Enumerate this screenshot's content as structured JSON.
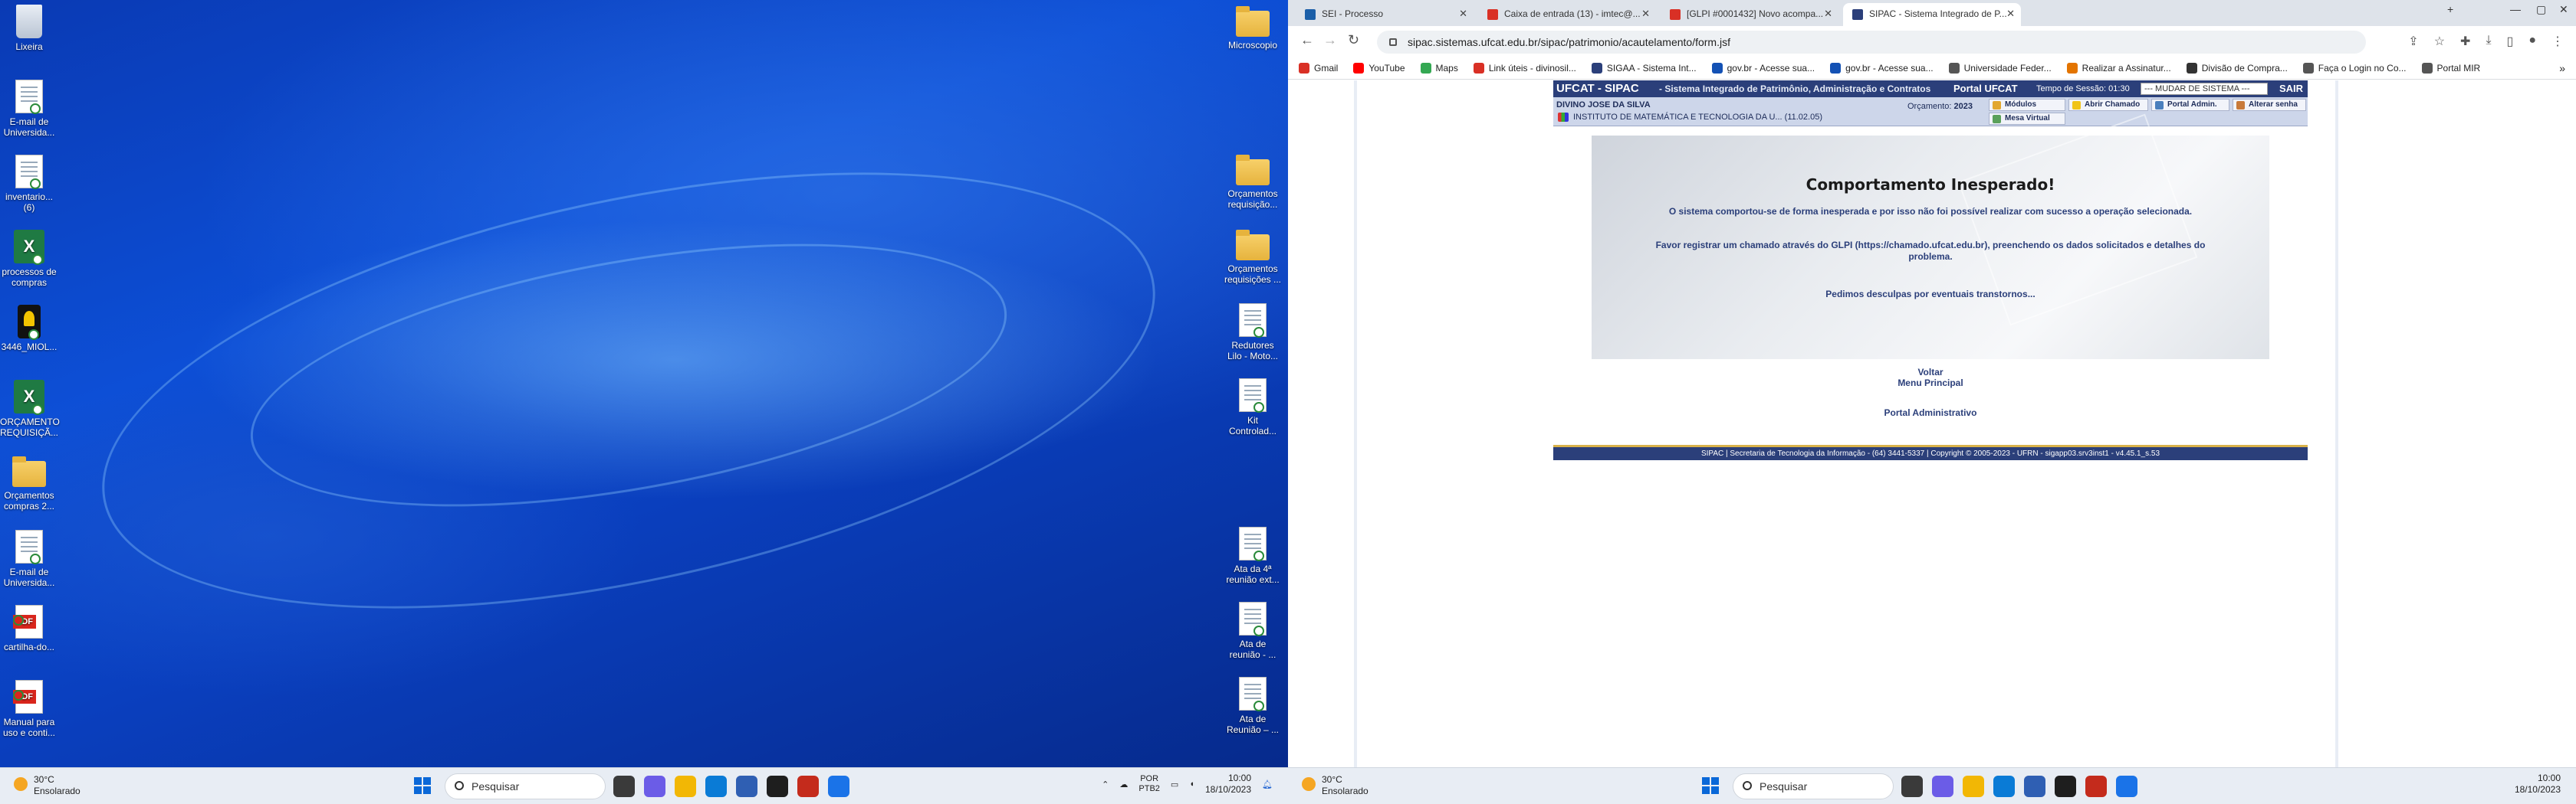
{
  "desktop": {
    "left_icons": [
      {
        "label": "Lixeira",
        "type": "recycle"
      },
      {
        "label": "E-mail de Universida...",
        "type": "doc"
      },
      {
        "label": "inventario... (6)",
        "type": "doc"
      },
      {
        "label": "processos de compras",
        "type": "excel"
      },
      {
        "label": "3446_MIOL...",
        "type": "black"
      },
      {
        "label": "ORÇAMENTO REQUISIÇÃ...",
        "type": "excel"
      },
      {
        "label": "Orçamentos compras 2...",
        "type": "folder"
      },
      {
        "label": "E-mail de Universida...",
        "type": "doc"
      },
      {
        "label": "cartilha-do...",
        "type": "pdf"
      },
      {
        "label": "Manual para uso e conti...",
        "type": "pdf"
      }
    ],
    "right_icons": [
      {
        "label": "Microscopio",
        "type": "folder"
      },
      {
        "label": "Orçamentos requisição...",
        "type": "folder"
      },
      {
        "label": "Orçamentos requisições ...",
        "type": "folder"
      },
      {
        "label": "Redutores Lilo - Moto...",
        "type": "doc"
      },
      {
        "label": "Kit Controlad...",
        "type": "doc"
      },
      {
        "label": "Ata da 4ª reunião ext...",
        "type": "doc"
      },
      {
        "label": "Ata de reunião - ...",
        "type": "doc"
      },
      {
        "label": "Ata de Reunião – ...",
        "type": "doc"
      }
    ],
    "pdf_badge": "PDF",
    "excel_badge": "X"
  },
  "taskbar": {
    "temp": "30°C",
    "weather": "Ensolarado",
    "search_placeholder": "Pesquisar",
    "lang1": "POR",
    "lang2": "PTB2",
    "time": "10:00",
    "date": "18/10/2023",
    "app_colors": [
      "#3a3a3a",
      "#6b5ce7",
      "#f2b705",
      "#0a7bd6",
      "#2f5fb3",
      "#1e1e1e",
      "#c42b1c",
      "#1a73e8"
    ]
  },
  "browser": {
    "tabs": [
      {
        "label": "SEI - Processo",
        "color": "#1b5fa8",
        "active": false
      },
      {
        "label": "Caixa de entrada (13) - imtec@...",
        "color": "#d93025",
        "active": false
      },
      {
        "label": "[GLPI #0001432] Novo acompa...",
        "color": "#d93025",
        "active": false
      },
      {
        "label": "SIPAC - Sistema Integrado de P...",
        "color": "#2b3f7a",
        "active": true
      }
    ],
    "url": "sipac.sistemas.ufcat.edu.br/sipac/patrimonio/acautelamento/form.jsf",
    "bookmarks": [
      {
        "label": "Gmail",
        "color": "#d93025"
      },
      {
        "label": "YouTube",
        "color": "#ff0000"
      },
      {
        "label": "Maps",
        "color": "#34a853"
      },
      {
        "label": "Link úteis - divinosil...",
        "color": "#d93025"
      },
      {
        "label": "SIGAA - Sistema Int...",
        "color": "#2b3f7a"
      },
      {
        "label": "gov.br - Acesse sua...",
        "color": "#1351b4"
      },
      {
        "label": "gov.br - Acesse sua...",
        "color": "#1351b4"
      },
      {
        "label": "Universidade Feder...",
        "color": "#555555"
      },
      {
        "label": "Realizar a Assinatur...",
        "color": "#e37400"
      },
      {
        "label": "Divisão de Compra...",
        "color": "#333333"
      },
      {
        "label": "Faça o Login no Co...",
        "color": "#555555"
      },
      {
        "label": "Portal MIR",
        "color": "#555555"
      }
    ]
  },
  "sipac": {
    "brand": "UFCAT - SIPAC",
    "subtitle": "- Sistema Integrado de Patrimônio, Administração e Contratos",
    "portal": "Portal UFCAT",
    "session": "Tempo de Sessão: 01:30",
    "change_system": "--- MUDAR DE SISTEMA ---",
    "logout": "SAIR",
    "user_name": "DIVINO JOSE DA SILVA",
    "unit": "INSTITUTO DE MATEMÁTICA E TECNOLOGIA DA U... (11.02.05)",
    "budget_label": "Orçamento:",
    "budget_year": "2023",
    "menu": {
      "modulos": "Módulos",
      "abrir_chamado": "Abrir Chamado",
      "portal_admin": "Portal Admin.",
      "alterar_senha": "Alterar senha",
      "mesa_virtual": "Mesa Virtual"
    },
    "error": {
      "title": "Comportamento Inesperado!",
      "msg1": "O sistema comportou-se de forma inesperada e por isso não foi possível realizar com sucesso a operação selecionada.",
      "msg2": "Favor registrar um chamado através do GLPI (https://chamado.ufcat.edu.br), preenchendo os dados solicitados e detalhes do problema.",
      "msg3": "Pedimos desculpas por eventuais transtornos..."
    },
    "links": {
      "voltar": "Voltar",
      "menu_principal": "Menu Principal",
      "portal_administrativo": "Portal Administrativo"
    },
    "footer": "SIPAC | Secretaria de Tecnologia da Informação - (64) 3441-5337 | Copyright © 2005-2023 - UFRN - sigapp03.srv3inst1 - v4.45.1_s.53"
  }
}
